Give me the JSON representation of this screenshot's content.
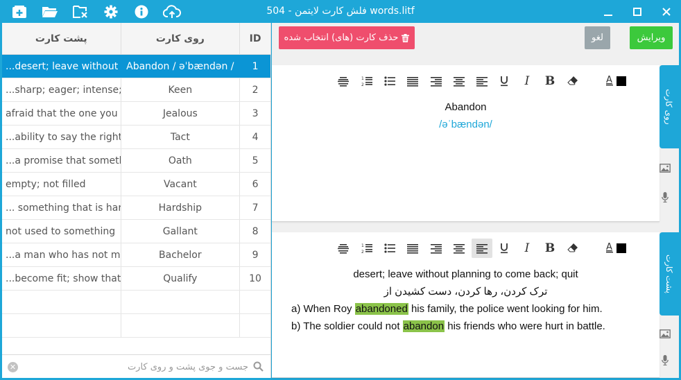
{
  "window": {
    "title": "فلش کارت لایتمن - 504 words.litf",
    "toolbar_icons": [
      "add-card-icon",
      "open-folder-icon",
      "close-file-icon",
      "settings-gear-icon",
      "info-icon",
      "cloud-upload-icon"
    ],
    "controls": [
      "minimize-icon",
      "maximize-icon",
      "close-icon"
    ]
  },
  "table": {
    "headers": {
      "back": "پشت کارت",
      "front": "روی کارت",
      "id": "ID"
    },
    "rows": [
      {
        "back": "...desert; leave without pl",
        "front": "Abandon / əˈbændən /",
        "id": "1"
      },
      {
        "back": "...sharp; eager; intense; s",
        "front": "Keen",
        "id": "2"
      },
      {
        "back": "afraid that the one you",
        "front": "Jealous",
        "id": "3"
      },
      {
        "back": "...ability to say the right t",
        "front": "Tact",
        "id": "4"
      },
      {
        "back": "...a promise that somethi",
        "front": "Oath",
        "id": "5"
      },
      {
        "back": "empty; not filled",
        "front": "Vacant",
        "id": "6"
      },
      {
        "back": "... something that is hard",
        "front": "Hardship",
        "id": "7"
      },
      {
        "back": "not used to something",
        "front": "Gallant",
        "id": "8"
      },
      {
        "back": "...a man who has not mar",
        "front": "Bachelor",
        "id": "9"
      },
      {
        "back": "...become fit; show that y",
        "front": "Qualify",
        "id": "10"
      }
    ],
    "selected_index": 0,
    "search_placeholder": "جست و جوی پشت و روی کارت"
  },
  "buttons": {
    "delete": "حذف کارت (های) انتخاب شده",
    "cancel": "لغو",
    "edit": "ویرایش"
  },
  "front_card": {
    "tab_label": "روی کارت",
    "word": "Abandon",
    "phonetic": "/əˈbændən/"
  },
  "back_card": {
    "tab_label": "پشت کارت",
    "definition": "desert; leave without planning to come back; quit",
    "persian": "ترک کردن، رها کردن، دست کشیدن از",
    "example_a_pre": "a) When Roy ",
    "example_a_hl": "abandoned",
    "example_a_post": " his family, the police went looking for him.",
    "example_b_pre": "b) The soldier could not ",
    "example_b_hl": "abandon",
    "example_b_post": " his friends who were hurt in battle."
  },
  "colors": {
    "accent": "#1ea7d8",
    "selected_row": "#0b95d5",
    "delete_button": "#ef4e6d",
    "edit_button": "#3cc93c",
    "cancel_button": "#9aa6ab",
    "highlight": "#8bc34a"
  }
}
